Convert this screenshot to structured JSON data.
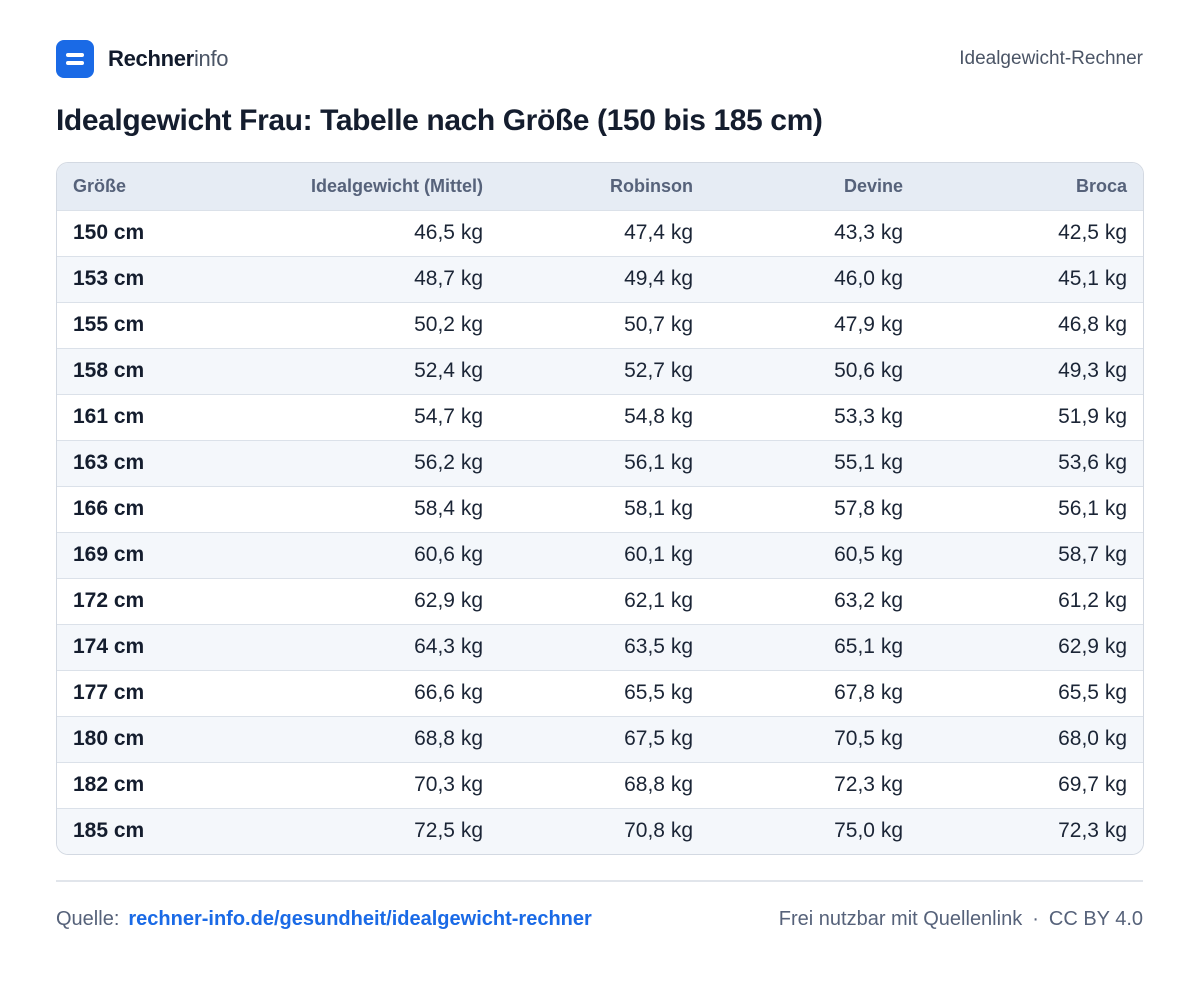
{
  "header": {
    "brand_strong": "Rechner",
    "brand_light": "info",
    "right_label": "Idealgewicht-Rechner"
  },
  "title": "Idealgewicht Frau: Tabelle nach Größe (150 bis 185 cm)",
  "table": {
    "columns": [
      "Größe",
      "Idealgewicht (Mittel)",
      "Robinson",
      "Devine",
      "Broca"
    ],
    "rows": [
      [
        "150 cm",
        "46,5 kg",
        "47,4 kg",
        "43,3 kg",
        "42,5 kg"
      ],
      [
        "153 cm",
        "48,7 kg",
        "49,4 kg",
        "46,0 kg",
        "45,1 kg"
      ],
      [
        "155 cm",
        "50,2 kg",
        "50,7 kg",
        "47,9 kg",
        "46,8 kg"
      ],
      [
        "158 cm",
        "52,4 kg",
        "52,7 kg",
        "50,6 kg",
        "49,3 kg"
      ],
      [
        "161 cm",
        "54,7 kg",
        "54,8 kg",
        "53,3 kg",
        "51,9 kg"
      ],
      [
        "163 cm",
        "56,2 kg",
        "56,1 kg",
        "55,1 kg",
        "53,6 kg"
      ],
      [
        "166 cm",
        "58,4 kg",
        "58,1 kg",
        "57,8 kg",
        "56,1 kg"
      ],
      [
        "169 cm",
        "60,6 kg",
        "60,1 kg",
        "60,5 kg",
        "58,7 kg"
      ],
      [
        "172 cm",
        "62,9 kg",
        "62,1 kg",
        "63,2 kg",
        "61,2 kg"
      ],
      [
        "174 cm",
        "64,3 kg",
        "63,5 kg",
        "65,1 kg",
        "62,9 kg"
      ],
      [
        "177 cm",
        "66,6 kg",
        "65,5 kg",
        "67,8 kg",
        "65,5 kg"
      ],
      [
        "180 cm",
        "68,8 kg",
        "67,5 kg",
        "70,5 kg",
        "68,0 kg"
      ],
      [
        "182 cm",
        "70,3 kg",
        "68,8 kg",
        "72,3 kg",
        "69,7 kg"
      ],
      [
        "185 cm",
        "72,5 kg",
        "70,8 kg",
        "75,0 kg",
        "72,3 kg"
      ]
    ]
  },
  "footer": {
    "source_label": "Quelle:",
    "source_link": "rechner-info.de/gesundheit/idealgewicht-rechner",
    "license_text": "Frei nutzbar mit Quellenlink",
    "separator": "·",
    "license": "CC BY 4.0"
  },
  "colors": {
    "accent": "#1a6ae6",
    "header_row_bg": "#e6ecf4",
    "stripe_bg": "#f4f7fb"
  },
  "icons": {
    "logo": "menu-lines-icon"
  }
}
